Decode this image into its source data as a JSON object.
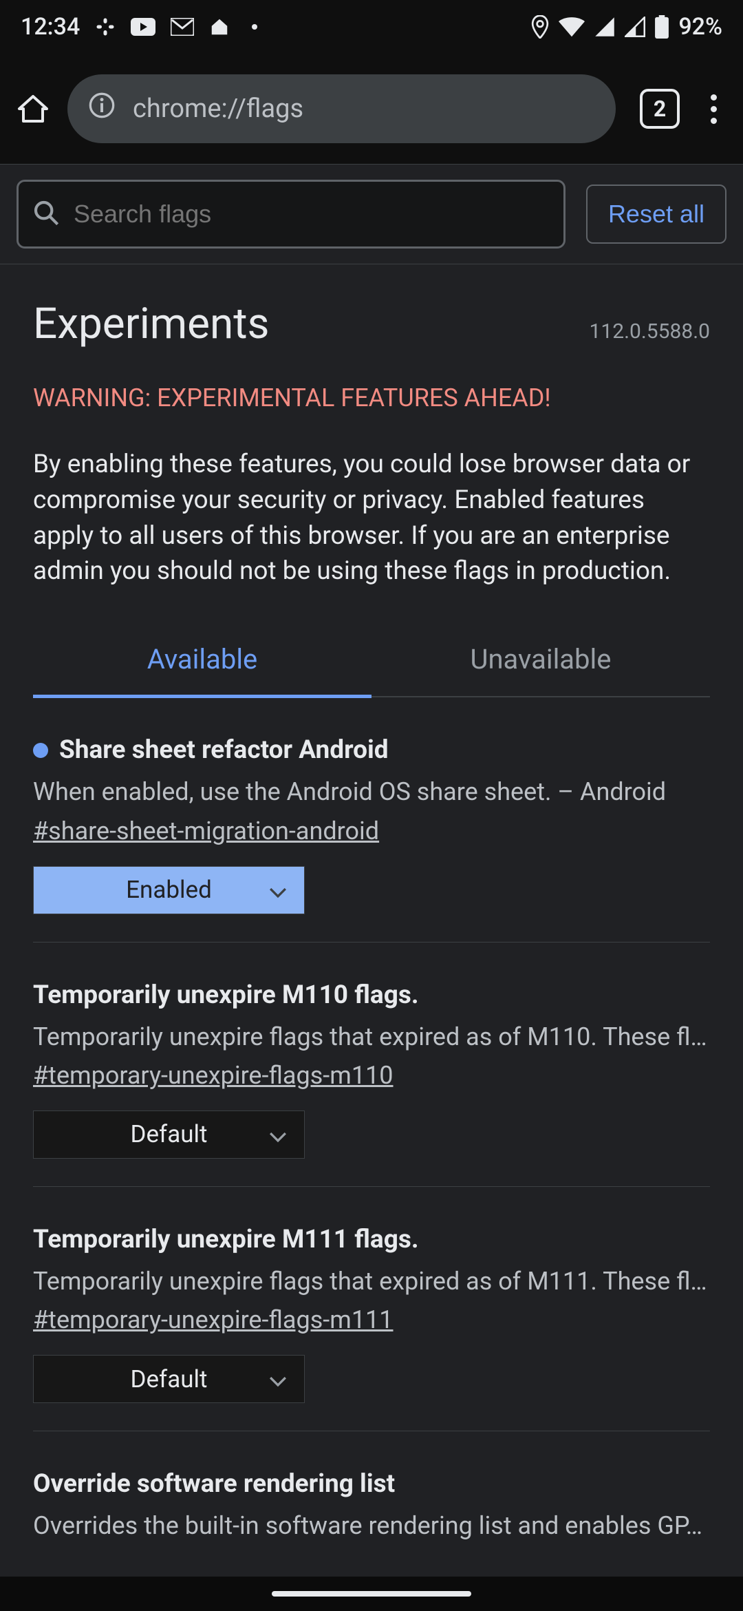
{
  "status": {
    "time": "12:34",
    "battery": "92%"
  },
  "browser": {
    "url": "chrome://flags",
    "tab_count": "2"
  },
  "search": {
    "placeholder": "Search flags",
    "reset_label": "Reset all"
  },
  "header": {
    "title": "Experiments",
    "version": "112.0.5588.0",
    "warning": "WARNING: EXPERIMENTAL FEATURES AHEAD!",
    "description": "By enabling these features, you could lose browser data or compromise your security or privacy. Enabled features apply to all users of this browser. If you are an enterprise admin you should not be using these flags in production."
  },
  "tabs": {
    "available": "Available",
    "unavailable": "Unavailable"
  },
  "flags": [
    {
      "title": "Share sheet refactor Android",
      "desc": "When enabled, use the Android OS share sheet. – Android",
      "link": "#share-sheet-migration-android",
      "value": "Enabled",
      "highlighted": true,
      "dot": true
    },
    {
      "title": "Temporarily unexpire M110 flags.",
      "desc": "Temporarily unexpire flags that expired as of M110. These fl…",
      "link": "#temporary-unexpire-flags-m110",
      "value": "Default",
      "highlighted": false,
      "dot": false
    },
    {
      "title": "Temporarily unexpire M111 flags.",
      "desc": "Temporarily unexpire flags that expired as of M111. These fl…",
      "link": "#temporary-unexpire-flags-m111",
      "value": "Default",
      "highlighted": false,
      "dot": false
    },
    {
      "title": "Override software rendering list",
      "desc": "Overrides the built-in software rendering list and enables GP…",
      "link": "",
      "value": "",
      "highlighted": false,
      "dot": false
    }
  ]
}
